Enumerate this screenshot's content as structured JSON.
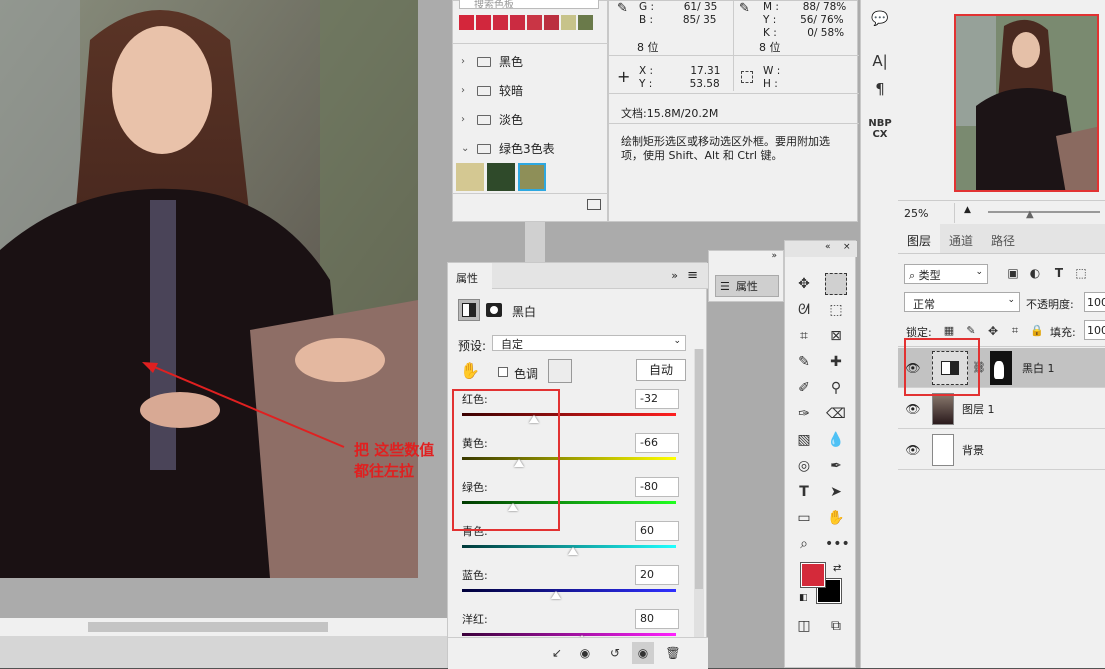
{
  "swatches": {
    "color_row": [
      "#d4263b",
      "#d1273d",
      "#cf2a40",
      "#cb2b41",
      "#c93545",
      "#bb2f3f",
      "#c7c38a",
      "#6a7a4a"
    ],
    "search_placeholder": "搜索色板",
    "folders": [
      {
        "name": "黑色"
      },
      {
        "name": "较暗"
      },
      {
        "name": "淡色"
      },
      {
        "name": "绿色3色表"
      }
    ],
    "green_set": [
      "#d4c892",
      "#2f4a2a",
      "#8e8f58"
    ]
  },
  "info": {
    "g_label": "G :",
    "g_val": "61/  35",
    "b_label": "B :",
    "b_val": "85/  35",
    "bit_left": "8 位",
    "m_label": "M :",
    "m_val": "88/  78%",
    "y_label": "Y :",
    "y_val": "56/  76%",
    "k_label": "K :",
    "k_val": "0/  58%",
    "bit_right": "8 位",
    "x_label": "X :",
    "x_val": "17.31",
    "y2_label": "Y :",
    "y2_val": "53.58",
    "w_label": "W :",
    "h_label": "H :",
    "doc": "文档:15.8M/20.2M",
    "hint": "绘制矩形选区或移动选区外框。要用附加选项，使用 Shift、Alt 和 Ctrl 键。"
  },
  "properties": {
    "tab": "属性",
    "title": "黑白",
    "preset_label": "预设:",
    "preset_value": "自定",
    "tint_label": "色调",
    "auto_label": "自动",
    "sliders": [
      {
        "label": "红色:",
        "value": -32,
        "gradient": [
          "#3a0000",
          "#ff2020"
        ]
      },
      {
        "label": "黄色:",
        "value": -66,
        "gradient": [
          "#3a3a00",
          "#ffff00"
        ]
      },
      {
        "label": "绿色:",
        "value": -80,
        "gradient": [
          "#003a00",
          "#20ff20"
        ]
      },
      {
        "label": "青色:",
        "value": 60,
        "gradient": [
          "#003a3a",
          "#20ffff"
        ]
      },
      {
        "label": "蓝色:",
        "value": 20,
        "gradient": [
          "#00003a",
          "#3030ff"
        ]
      },
      {
        "label": "洋红:",
        "value": 80,
        "gradient": [
          "#3a003a",
          "#ff20ff"
        ]
      }
    ]
  },
  "mini_panel": {
    "label": "属性"
  },
  "annotation": {
    "line1": "把 这些数值",
    "line2": "都往左拉"
  },
  "navigator": {
    "zoom": "25%"
  },
  "layers": {
    "tabs": [
      "图层",
      "通道",
      "路径"
    ],
    "filter_label": "类型",
    "blend_mode": "正常",
    "opacity_label": "不透明度:",
    "opacity_value": "100",
    "lock_label": "锁定:",
    "fill_label": "填充:",
    "fill_value": "100",
    "items": [
      {
        "name": "黑白 1"
      },
      {
        "name": "图层 1"
      },
      {
        "name": "背景"
      }
    ]
  },
  "colors": {
    "foreground": "#d42a3a",
    "background": "#000000",
    "accent_red": "#e23232"
  }
}
